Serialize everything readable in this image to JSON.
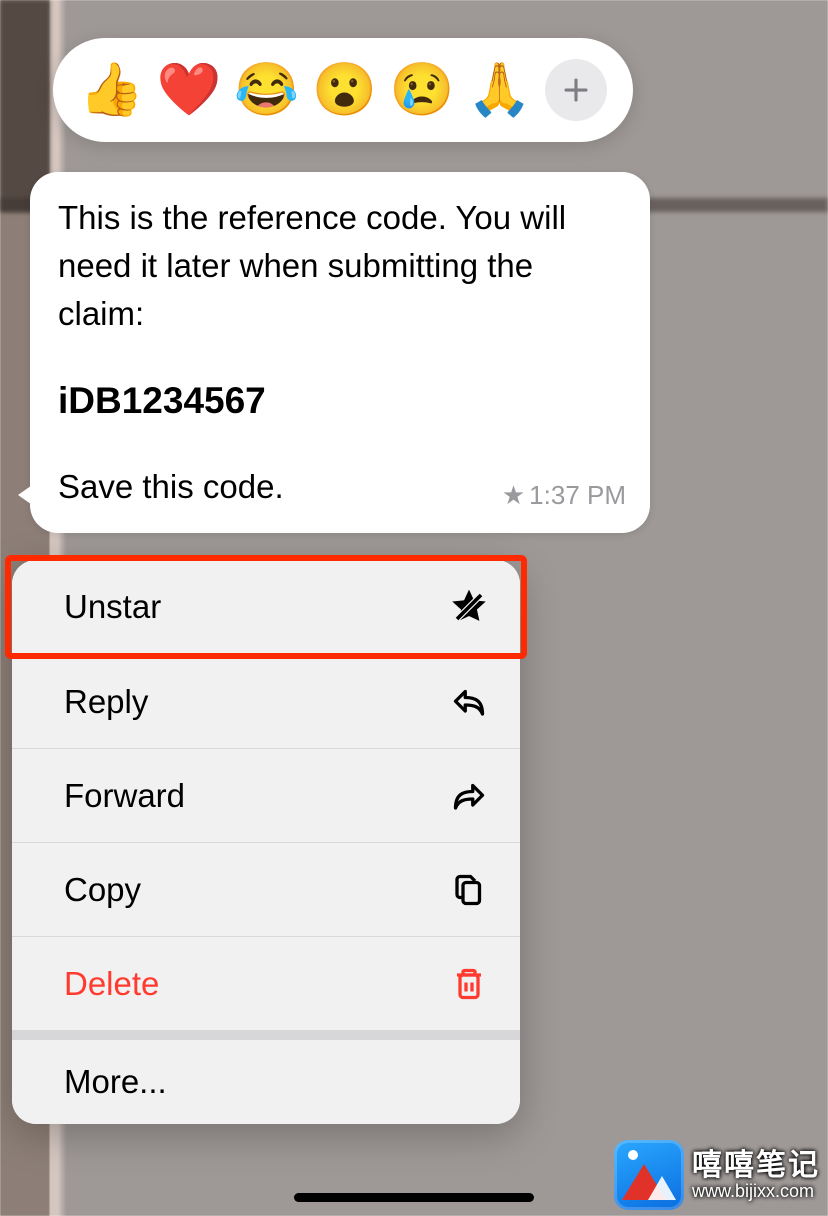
{
  "reactions": {
    "items": [
      "👍",
      "❤️",
      "😂",
      "😮",
      "😢",
      "🙏"
    ],
    "add_label": "+"
  },
  "message": {
    "p1": "This is the reference code. You will need it later when submitting the claim:",
    "code": "iDB1234567",
    "p2": "Save this code.",
    "starred": true,
    "time": "1:37 PM"
  },
  "menu": {
    "items": [
      {
        "key": "unstar",
        "label": "Unstar",
        "icon": "unstar-icon",
        "danger": false,
        "section_break": false
      },
      {
        "key": "reply",
        "label": "Reply",
        "icon": "reply-icon",
        "danger": false,
        "section_break": false
      },
      {
        "key": "forward",
        "label": "Forward",
        "icon": "forward-icon",
        "danger": false,
        "section_break": false
      },
      {
        "key": "copy",
        "label": "Copy",
        "icon": "copy-icon",
        "danger": false,
        "section_break": false
      },
      {
        "key": "delete",
        "label": "Delete",
        "icon": "trash-icon",
        "danger": true,
        "section_break": false
      },
      {
        "key": "more",
        "label": "More...",
        "icon": "",
        "danger": false,
        "section_break": true
      }
    ],
    "highlighted_index": 0
  },
  "watermark": {
    "title": "嘻嘻笔记",
    "url": "www.bijixx.com"
  }
}
